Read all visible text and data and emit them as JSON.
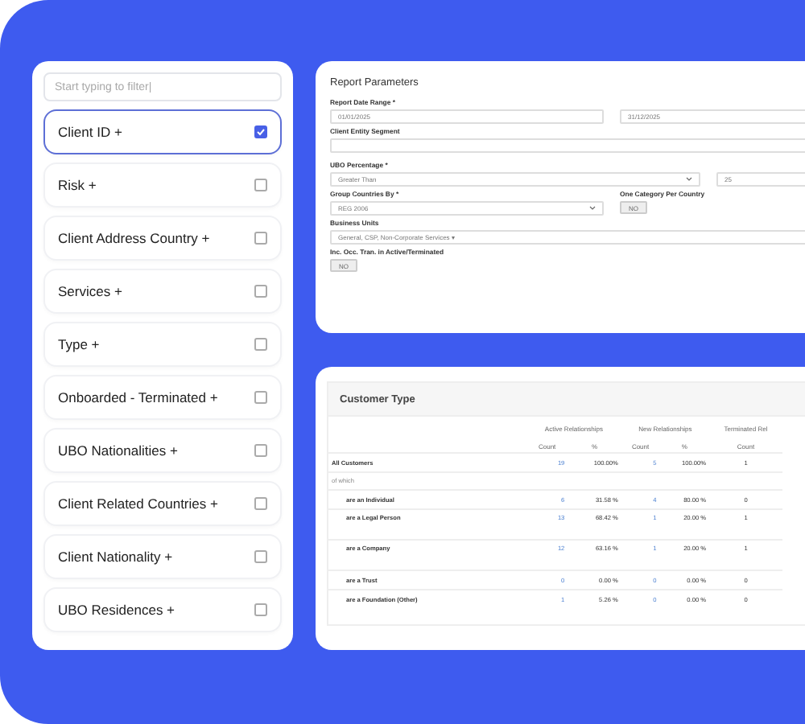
{
  "filter": {
    "placeholder": "Start typing to filter|"
  },
  "fields": [
    {
      "label": "Client ID +",
      "checked": true
    },
    {
      "label": "Risk +",
      "checked": false
    },
    {
      "label": "Client Address Country +",
      "checked": false
    },
    {
      "label": "Services +",
      "checked": false
    },
    {
      "label": "Type +",
      "checked": false
    },
    {
      "label": "Onboarded - Terminated +",
      "checked": false
    },
    {
      "label": "UBO Nationalities +",
      "checked": false
    },
    {
      "label": "Client Related Countries +",
      "checked": false
    },
    {
      "label": "Client Nationality +",
      "checked": false
    },
    {
      "label": "UBO Residences +",
      "checked": false
    }
  ],
  "report_parameters": {
    "title": "Report Parameters",
    "date_range": {
      "label": "Report Date Range *",
      "from": "01/01/2025",
      "to": "31/12/2025"
    },
    "segment": {
      "label": "Client Entity Segment"
    },
    "ubo": {
      "label": "UBO Percentage *",
      "operator": "Greater Than",
      "value": "25"
    },
    "group_by": {
      "label": "Group Countries By *",
      "value": "REG 2006"
    },
    "one_category": {
      "label": "One Category Per Country",
      "toggle": "NO"
    },
    "business_units": {
      "label": "Business Units",
      "value": "General, CSP, Non-Corporate Services ▾"
    },
    "inc_occ": {
      "label": "Inc. Occ. Tran. in Active/Terminated",
      "toggle": "NO"
    }
  },
  "customer_type": {
    "title": "Customer Type",
    "groups": [
      "Active Relationships",
      "New Relationships",
      "Terminated Rel"
    ],
    "subcolumns": [
      "Count",
      "%",
      "Count",
      "%",
      "Count"
    ],
    "rows": [
      {
        "label": "All Customers",
        "kind": "total",
        "cells": [
          "19",
          "100.00%",
          "5",
          "100.00%",
          "1"
        ]
      },
      {
        "label": "of which",
        "kind": "note",
        "cells": []
      },
      {
        "label": "are an Individual",
        "kind": "sub",
        "cells": [
          "6",
          "31.58 %",
          "4",
          "80.00 %",
          "0"
        ]
      },
      {
        "label": "are a Legal Person",
        "kind": "tall",
        "cells": [
          "13",
          "68.42 %",
          "1",
          "20.00 %",
          "1"
        ]
      },
      {
        "label": "are a Company",
        "kind": "tall",
        "cells": [
          "12",
          "63.16 %",
          "1",
          "20.00 %",
          "1"
        ]
      },
      {
        "label": "are a Trust",
        "kind": "sub",
        "cells": [
          "0",
          "0.00 %",
          "0",
          "0.00 %",
          "0"
        ]
      },
      {
        "label": "are a Foundation (Other)",
        "kind": "sub",
        "cells": [
          "1",
          "5.26 %",
          "0",
          "0.00 %",
          "0"
        ]
      }
    ]
  }
}
